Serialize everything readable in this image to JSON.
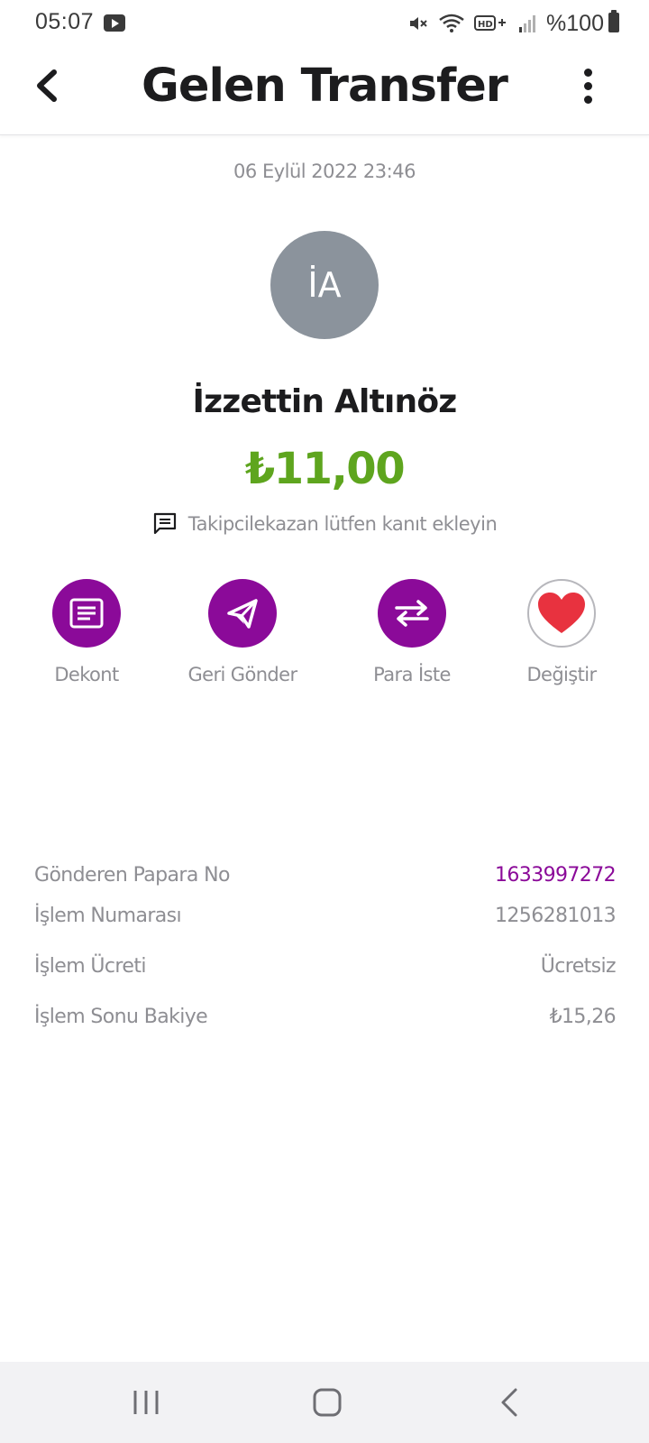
{
  "status_bar": {
    "time": "05:07",
    "battery": "%100"
  },
  "header": {
    "title": "Gelen Transfer"
  },
  "transaction": {
    "date": "06 Eylül 2022 23:46",
    "avatar_initials": "İA",
    "sender_name": "İzzettin Altınöz",
    "amount": "₺11,00",
    "note": "Takipcilekazan lütfen kanıt ekleyin"
  },
  "actions": [
    {
      "label": "Dekont",
      "icon": "receipt-icon"
    },
    {
      "label": "Geri Gönder",
      "icon": "send-icon"
    },
    {
      "label": "Para İste",
      "icon": "swap-arrows-icon"
    },
    {
      "label": "Değiştir",
      "icon": "heart-icon"
    }
  ],
  "details": [
    {
      "label": "Gönderen Papara No",
      "value": "1633997272"
    },
    {
      "label": "İşlem Numarası",
      "value": "1256281013"
    },
    {
      "label": "İşlem Ücreti",
      "value": "Ücretsiz"
    },
    {
      "label": "İşlem Sonu Bakiye",
      "value": "₺15,26"
    }
  ],
  "colors": {
    "brand_purple": "#8b0a99",
    "amount_green": "#5ea51e",
    "heart_red": "#e8323f",
    "avatar_gray": "#8b939c"
  }
}
